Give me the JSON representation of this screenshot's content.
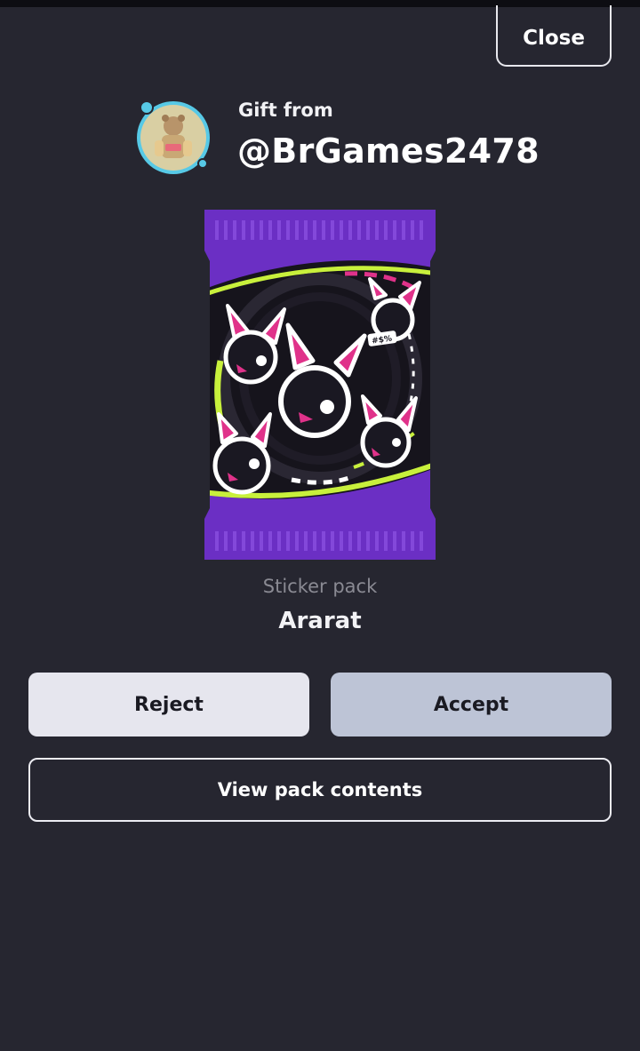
{
  "header": {
    "close_label": "Close"
  },
  "gift": {
    "from_label": "Gift from",
    "username": "@BrGames2478"
  },
  "pack": {
    "type": "Sticker pack",
    "name": "Ararat",
    "art_tag": "#$%"
  },
  "actions": {
    "reject_label": "Reject",
    "accept_label": "Accept",
    "view_contents_label": "View pack contents"
  },
  "colors": {
    "background": "#262630",
    "pack_purple": "#6b2fc4",
    "accent_lime": "#c8f03c",
    "accent_pink": "#e0328a",
    "accept_button": "#bdc4d6",
    "reject_button": "#e6e6ee"
  }
}
